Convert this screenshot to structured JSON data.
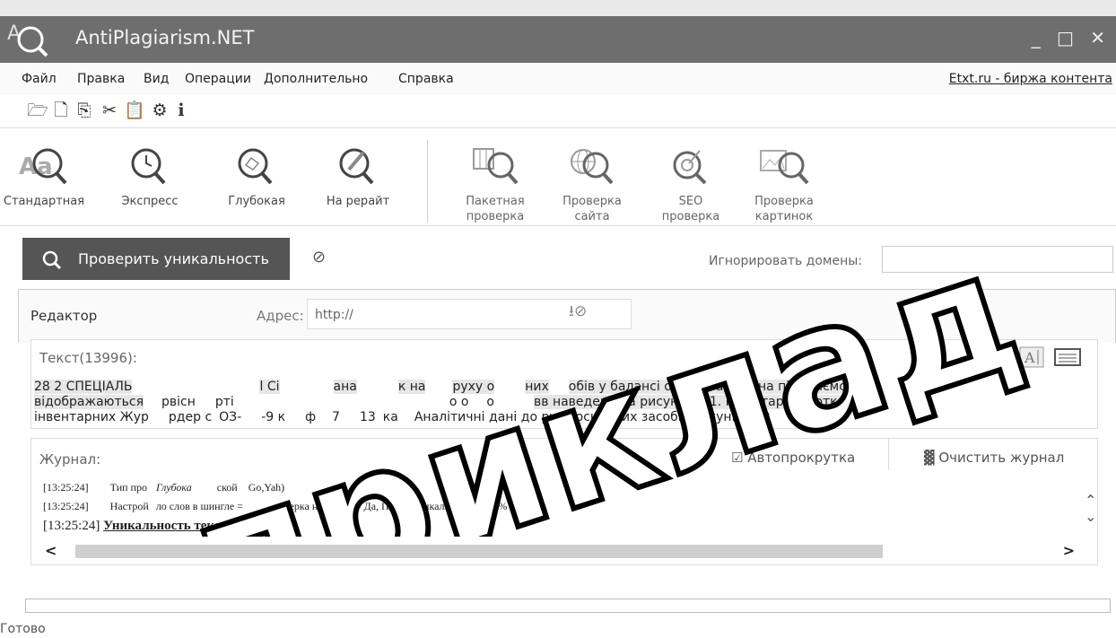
{
  "window": {
    "title": "AntiPlagiarism.NET",
    "controls": "_ □ ✕"
  },
  "menu": {
    "items": [
      "Файл",
      "Правка",
      "Вид",
      "Операции",
      "Дополнительно",
      "Справка"
    ],
    "link": "Etxt.ru - биржа контента"
  },
  "ribbon": {
    "buttons": [
      "Стандартная",
      "Экспресс",
      "Глубокая",
      "На рерайт"
    ],
    "buttons2": [
      [
        "Пакетная",
        "проверка"
      ],
      [
        "Проверка",
        "сайта"
      ],
      [
        "SEO",
        "проверка"
      ],
      [
        "Проверка",
        "картинок"
      ]
    ]
  },
  "actions": {
    "check": "Проверить уникальность",
    "ignore_domains_label": "Игнорировать домены:"
  },
  "editor": {
    "label": "Редактор",
    "address_label": "Адрес:",
    "address_placeholder": "http://"
  },
  "text": {
    "header": "Текст(13996):",
    "line1_a": "28 2 СПЕЦІАЛЬ",
    "line1_b": "l Сі",
    "line1_c": "ана",
    "line1_d": "к на",
    "line1_e": "руху о",
    "line1_f": "них",
    "line1_g": "обів у балансі основ",
    "line1_h": "засоби на підприємстві",
    "line2_a": "відображаються",
    "line2_b": "рвісн",
    "line2_c": "рті",
    "line2_d": "о о",
    "line2_e": "о",
    "line2_f": "вв наведена на рисунку 2.1. Інвентарні картки Опис",
    "line3_a": "інвентарних Жур",
    "line3_b": "рдер с",
    "line3_c": "ОЗ-",
    "line3_d": "-9 к",
    "line3_e": "ф",
    "line3_f": "7",
    "line3_g": "13",
    "line3_h": "ка",
    "line3_i": "Аналітичні дані до руху основних засобів рахунків 10"
  },
  "journal": {
    "label": "Журнал:",
    "autoscroll": "Автопрокрутка",
    "clear": "Очистить журнал",
    "l1_time": "[13:25:24]",
    "l1_a": "Тип про",
    "l1_b": "Глубока",
    "l1_c": "ской",
    "l1_d": "Go,Yah)",
    "l2_time": "[13:25:24]",
    "l2_a": "Настрой",
    "l2_b": "ло слов в шингле =",
    "l2_c": "роверка на дубли = Да, Порог уникальности = 10%",
    "l3_time": "[13:25:24]",
    "l3_bold": "Уникальность текста 83%",
    "l3_rest": " / "
  },
  "status": "Готово",
  "watermark": "приклад"
}
